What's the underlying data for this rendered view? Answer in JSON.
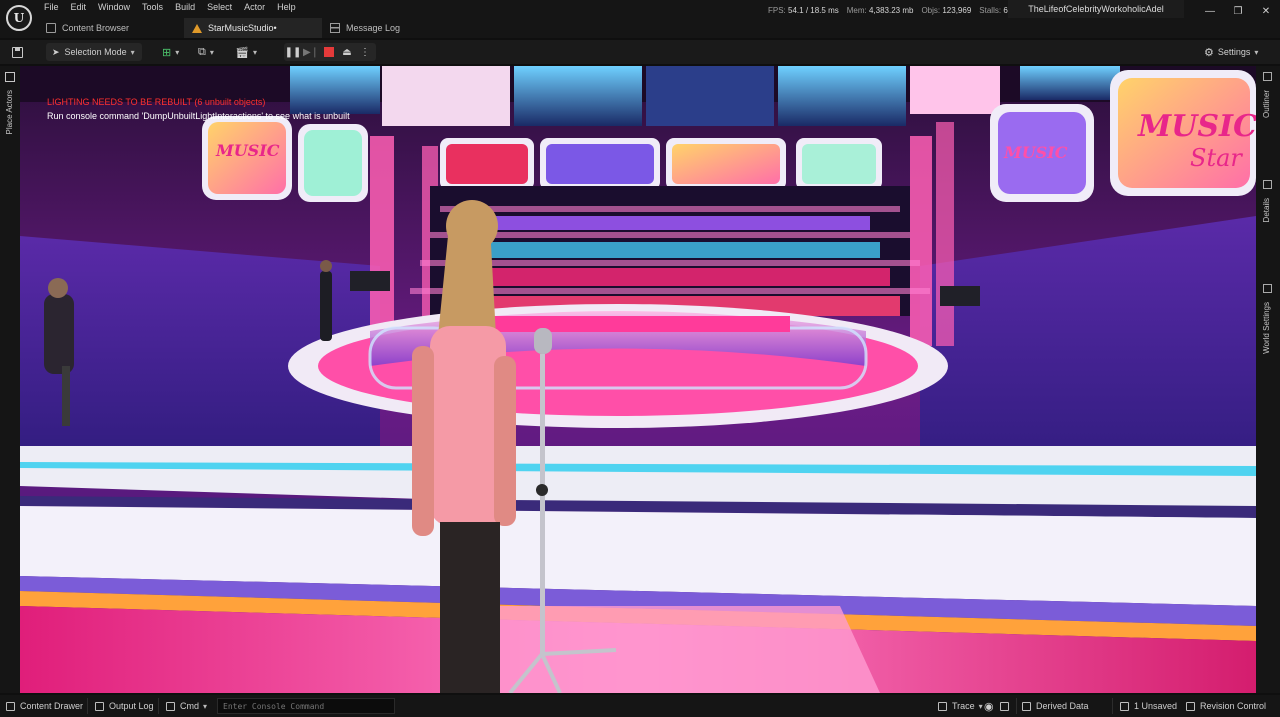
{
  "app": {
    "logo_glyph": "U",
    "menu": [
      "File",
      "Edit",
      "Window",
      "Tools",
      "Build",
      "Select",
      "Actor",
      "Help"
    ],
    "tabs": [
      {
        "label": "Content Browser",
        "icon": "folder-icon"
      },
      {
        "label": "StarMusicStudio•",
        "icon": "level-icon"
      },
      {
        "label": "Message Log",
        "icon": "message-log-icon"
      }
    ],
    "stats": {
      "fps_label": "FPS:",
      "fps": "54.1",
      "frame_time": "/ 18.5 ms",
      "mem_label": "Mem:",
      "mem": "4,383.23 mb",
      "objs_label": "Objs:",
      "objs": "123,969",
      "stalls_label": "Stalls:",
      "stalls": "6"
    },
    "project_name": "TheLifeofCelebrityWorkoholicAdel",
    "window_controls": {
      "minimize": "—",
      "restore": "❐",
      "close": "✕"
    }
  },
  "toolbar": {
    "selection_mode": "Selection Mode",
    "settings": "Settings"
  },
  "side_tabs": {
    "left": [
      "Place Actors"
    ],
    "right": [
      "Outliner",
      "Details",
      "World Settings"
    ]
  },
  "viewport": {
    "warning": "LIGHTING NEEDS TO BE REBUILT (6 unbuilt objects)",
    "hint": "Run console command 'DumpUnbuiltLightInteractions' to see what is unbuilt",
    "signs": [
      "MUSIC",
      "Star"
    ]
  },
  "statusbar": {
    "content_drawer": "Content Drawer",
    "output_log": "Output Log",
    "cmd": "Cmd",
    "console_placeholder": "Enter Console Command",
    "trace": "Trace",
    "derived_data": "Derived Data",
    "unsaved": "1 Unsaved",
    "revision_control": "Revision Control"
  },
  "colors": {
    "accent_orange": "#e09a2a",
    "stop_red": "#e53a3a",
    "warning_red": "#ff3030"
  }
}
